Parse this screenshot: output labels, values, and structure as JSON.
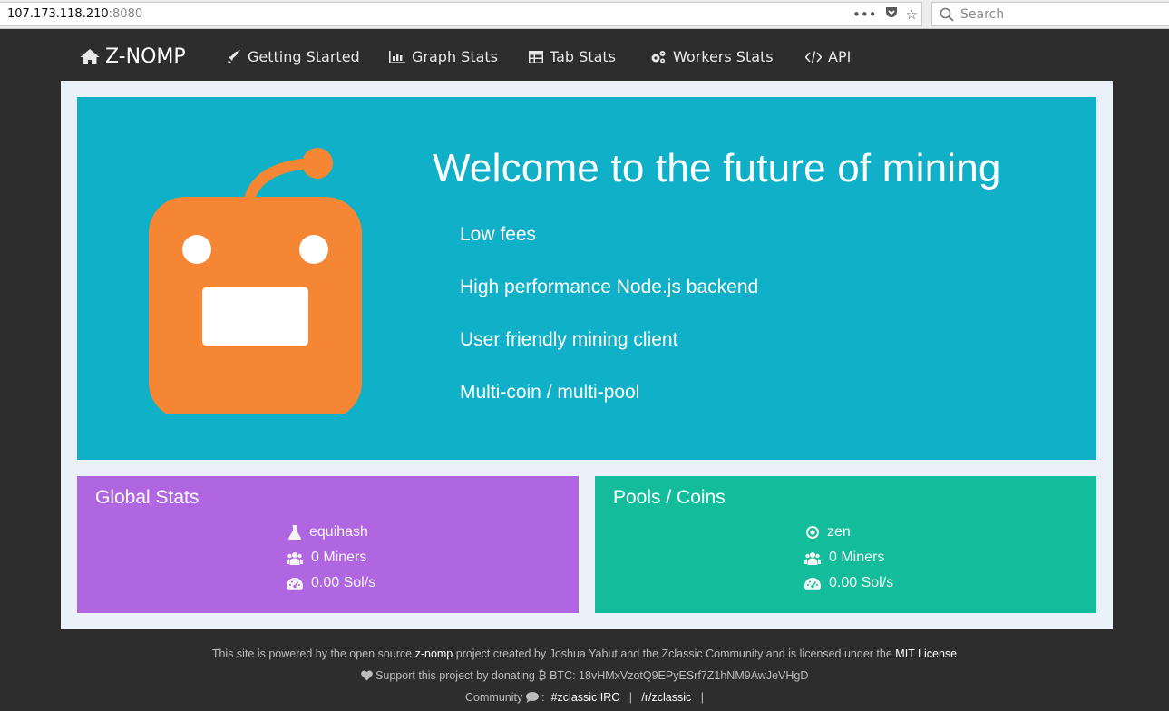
{
  "browser": {
    "url_host": "107.173.118.210",
    "url_port": ":8080",
    "search_placeholder": "Search"
  },
  "nav": {
    "brand": "Z-NOMP",
    "links": [
      {
        "label": "Getting Started",
        "icon": "rocket-icon"
      },
      {
        "label": "Graph Stats",
        "icon": "bar-chart-icon"
      },
      {
        "label": "Tab Stats",
        "icon": "table-icon"
      },
      {
        "label": "Workers Stats",
        "icon": "gears-icon"
      },
      {
        "label": "API",
        "icon": "code-icon"
      }
    ]
  },
  "hero": {
    "title": "Welcome to the future of mining",
    "features": [
      "Low fees",
      "High performance Node.js backend",
      "User friendly mining client",
      "Multi-coin / multi-pool"
    ]
  },
  "global_stats": {
    "title": "Global Stats",
    "algorithm": "equihash",
    "miners": "0 Miners",
    "hashrate": "0.00 Sol/s"
  },
  "pools": {
    "title": "Pools / Coins",
    "coin": "zen",
    "miners": "0 Miners",
    "hashrate": "0.00 Sol/s"
  },
  "footer": {
    "line1_pre": "This site is powered by the open source ",
    "line1_project": "z-nomp",
    "line1_mid": " project created by Joshua Yabut and the Zclassic Community and is licensed under the ",
    "line1_license": "MIT License",
    "line2_pre": " Support this project by donating ",
    "line2_btc": " BTC: 18vHMxVzotQ9EPyESrf7Z1hNM9AwJeVHgD",
    "line3_pre": "Community ",
    "line3_colon": " :",
    "irc": "#zclassic IRC",
    "sep": "|",
    "reddit": "/r/zclassic"
  },
  "colors": {
    "hero": "#10b0c8",
    "global_card": "#b066e0",
    "pools_card": "#13bc9a",
    "robot": "#f58634",
    "navbar": "#2d2d2d"
  }
}
